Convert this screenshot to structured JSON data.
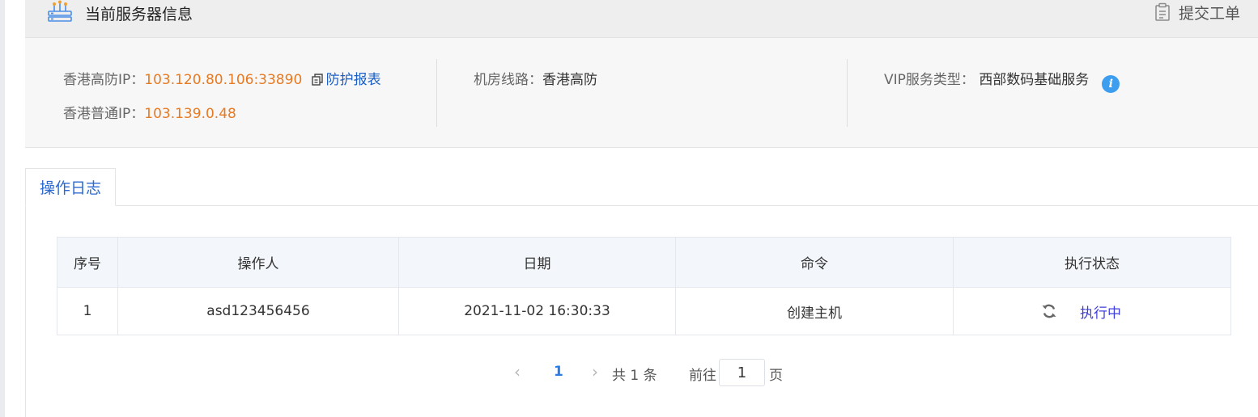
{
  "header": {
    "title": "当前服务器信息",
    "ticket_button": "提交工单"
  },
  "server_info": {
    "hk_ddos_ip_label": "香港高防IP：",
    "hk_ddos_ip_value": "103.120.80.106:33890",
    "protection_report_link": "防护报表",
    "hk_normal_ip_label": "香港普通IP：",
    "hk_normal_ip_value": "103.139.0.48",
    "line_label": "机房线路：",
    "line_value": "香港高防",
    "vip_type_label": "VIP服务类型：",
    "vip_type_value": "西部数码基础服务"
  },
  "tabs": [
    {
      "label": "操作日志",
      "active": true
    }
  ],
  "log_table": {
    "columns": [
      "序号",
      "操作人",
      "日期",
      "命令",
      "执行状态"
    ],
    "rows": [
      {
        "index": "1",
        "operator": "asd123456456",
        "date": "2021-11-02 16:30:33",
        "command": "创建主机",
        "status": "执行中"
      }
    ]
  },
  "pagination": {
    "current_page": "1",
    "total_text": "共 1 条",
    "goto_label": "前往",
    "goto_value": "1",
    "page_suffix": "页"
  },
  "colors": {
    "accent_blue": "#2d6ad0",
    "ip_orange": "#e67a22",
    "status_purple": "#3e3ed8",
    "info_icon_blue": "#3d9ef0"
  },
  "icons": [
    "server-icon",
    "clipboard-icon",
    "copy-icon",
    "info-icon",
    "refresh-icon",
    "chevron-left-icon",
    "chevron-right-icon"
  ]
}
